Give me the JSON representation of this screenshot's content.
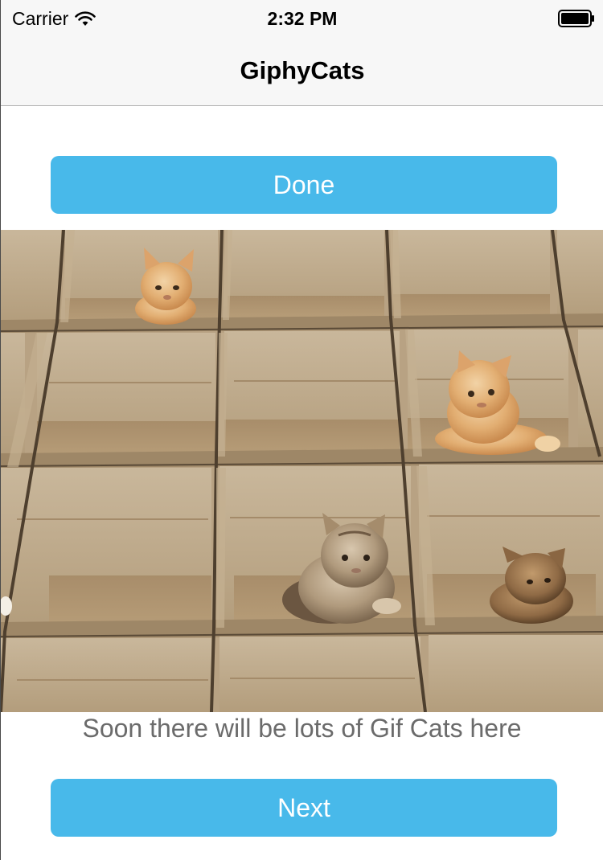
{
  "status_bar": {
    "carrier": "Carrier",
    "time": "2:32 PM",
    "wifi_icon": "wifi-icon",
    "battery_icon": "battery-full-icon"
  },
  "nav": {
    "title": "GiphyCats"
  },
  "buttons": {
    "done_label": "Done",
    "next_label": "Next"
  },
  "gif": {
    "description_icon": "cat-gif-image",
    "caption": "Soon there will be lots of Gif Cats here"
  },
  "colors": {
    "button_blue": "#48b9ea",
    "nav_background": "#f7f7f7",
    "caption_gray": "#6b6b6b"
  }
}
